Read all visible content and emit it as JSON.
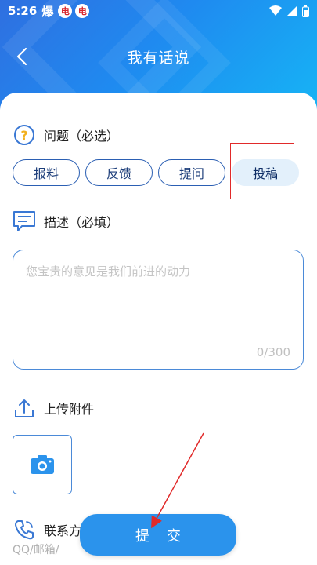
{
  "status_bar": {
    "time": "5:26",
    "carrier_text": "爆",
    "badge1": "电",
    "badge2": "电"
  },
  "nav": {
    "title": "我有话说"
  },
  "question_section": {
    "label": "问题（必选）",
    "options": [
      "报料",
      "反馈",
      "提问",
      "投稿"
    ],
    "selected": "投稿"
  },
  "description_section": {
    "label": "描述（必填）",
    "placeholder": "您宝贵的意见是我们前进的动力",
    "counter": "0/300"
  },
  "upload_section": {
    "label": "上传附件"
  },
  "contact_section": {
    "label": "联系方",
    "hint": "QQ/邮箱/"
  },
  "submit": {
    "label": "提交"
  },
  "colors": {
    "accent": "#2b93ec",
    "chip_border": "#2b5fb3",
    "selected_bg": "#e3f0fb",
    "highlight": "#e12a2a"
  }
}
